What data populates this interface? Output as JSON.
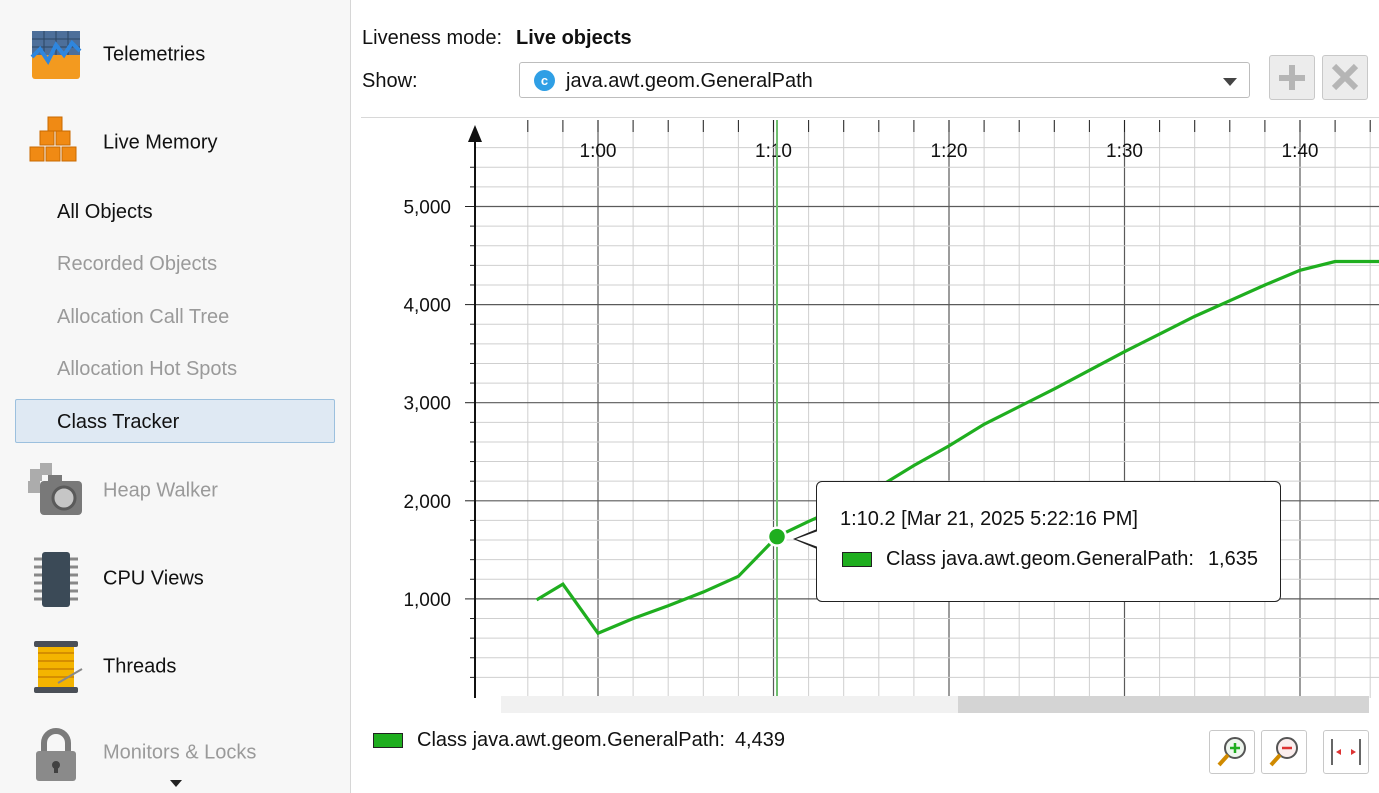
{
  "sidebar": {
    "items": [
      {
        "label": "Telemetries",
        "icon": "telemetries-icon",
        "enabled": true
      },
      {
        "label": "Live Memory",
        "icon": "live-memory-icon",
        "enabled": true
      },
      {
        "label": "Heap Walker",
        "icon": "heap-walker-icon",
        "enabled": false
      },
      {
        "label": "CPU Views",
        "icon": "cpu-views-icon",
        "enabled": true
      },
      {
        "label": "Threads",
        "icon": "threads-icon",
        "enabled": true
      },
      {
        "label": "Monitors & Locks",
        "icon": "monitors-locks-icon",
        "enabled": false
      }
    ],
    "live_memory_sub": [
      {
        "label": "All Objects",
        "enabled": true
      },
      {
        "label": "Recorded Objects",
        "enabled": false
      },
      {
        "label": "Allocation Call Tree",
        "enabled": false
      },
      {
        "label": "Allocation Hot Spots",
        "enabled": false
      },
      {
        "label": "Class Tracker",
        "enabled": true,
        "selected": true
      }
    ]
  },
  "header": {
    "liveness_label": "Liveness mode:",
    "liveness_value": "Live objects",
    "show_label": "Show:",
    "show_value": "java.awt.geom.GeneralPath",
    "show_icon_letter": "c"
  },
  "toolbar": {
    "add": "add-icon",
    "remove": "remove-icon"
  },
  "chart_data": {
    "type": "line",
    "x_tick_labels": [
      "1:00",
      "1:10",
      "1:20",
      "1:30",
      "1:40"
    ],
    "y_tick_labels": [
      "1,000",
      "2,000",
      "3,000",
      "4,000",
      "5,000"
    ],
    "x_unit": "seconds",
    "xlim": [
      55,
      105
    ],
    "ylim": [
      0,
      5600
    ],
    "series": [
      {
        "name": "Class java.awt.geom.GeneralPath",
        "color": "#1fae1f",
        "x": [
          56.5,
          58.0,
          60.0,
          62.0,
          64.0,
          66.0,
          68.0,
          70.2,
          72.0,
          74.0,
          76.0,
          78.0,
          80.0,
          82.0,
          84.0,
          86.0,
          88.0,
          90.0,
          92.0,
          94.0,
          96.0,
          98.0,
          100.0,
          102.0,
          104.0,
          105.0
        ],
        "y": [
          990,
          1150,
          650,
          800,
          930,
          1070,
          1230,
          1635,
          1790,
          1950,
          2140,
          2360,
          2560,
          2780,
          2960,
          3140,
          3330,
          3520,
          3700,
          3880,
          4040,
          4200,
          4350,
          4439,
          4439,
          4439
        ]
      }
    ],
    "crosshair_x": 70.2,
    "grid": true
  },
  "tooltip": {
    "time_line": "1:10.2 [Mar 21, 2025 5:22:16 PM]",
    "series_label": "Class java.awt.geom.GeneralPath:",
    "series_value": "1,635"
  },
  "legend": {
    "label": "Class java.awt.geom.GeneralPath:",
    "value": "4,439"
  },
  "zoom_buttons": [
    "zoom-in-icon",
    "zoom-out-icon",
    "fit-width-icon"
  ]
}
